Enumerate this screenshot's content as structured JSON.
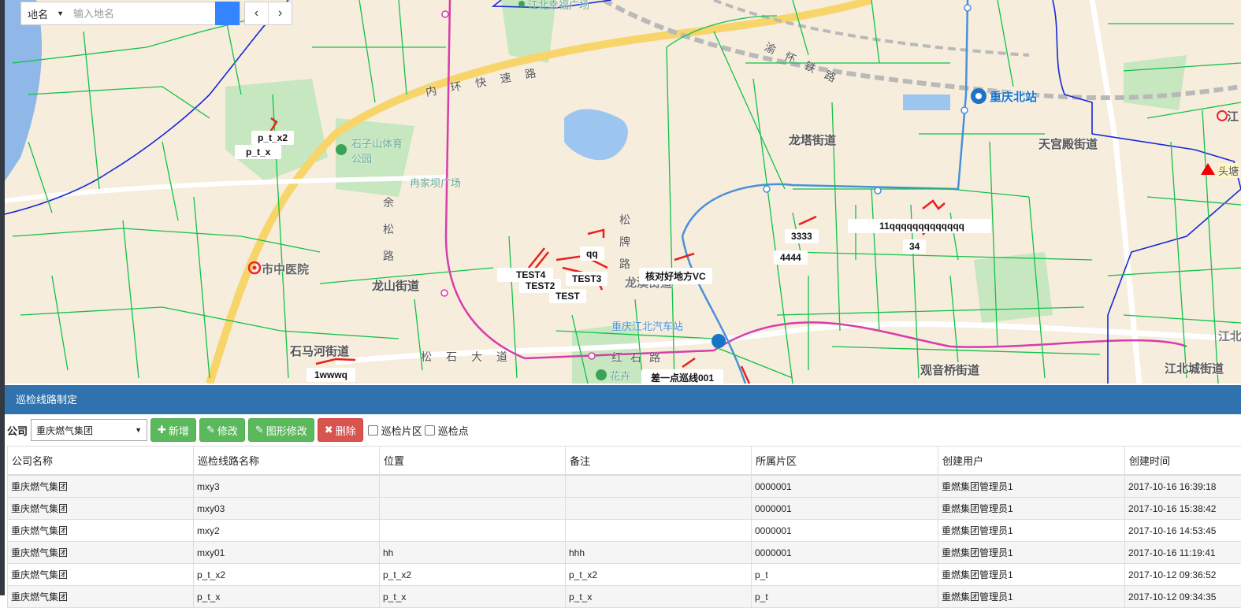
{
  "search": {
    "type_label": "地名",
    "placeholder": "输入地名"
  },
  "map": {
    "labels": [
      {
        "id": "ptx2",
        "text": "p_t_x2"
      },
      {
        "id": "ptx",
        "text": "p_t_x"
      },
      {
        "id": "3333",
        "text": "3333"
      },
      {
        "id": "4444",
        "text": "4444"
      },
      {
        "id": "11q",
        "text": "11qqqqqqqqqqqqq"
      },
      {
        "id": "34",
        "text": "34"
      },
      {
        "id": "qq",
        "text": "qq"
      },
      {
        "id": "test4",
        "text": "TEST4"
      },
      {
        "id": "test3",
        "text": "TEST3"
      },
      {
        "id": "test2",
        "text": "TEST2"
      },
      {
        "id": "test",
        "text": "TEST"
      },
      {
        "id": "vc",
        "text": "核对好地方VC"
      },
      {
        "id": "1wwwq",
        "text": "1wwwq"
      },
      {
        "id": "cha",
        "text": "差一点巡线001"
      }
    ],
    "pois": {
      "longshan": "龙山街道",
      "longta": "龙塔街道",
      "tiangong": "天宫殿街道",
      "shimahe": "石马河街道",
      "guanyinqiao": "观音桥街道",
      "jiangbeicheng": "江北城街道",
      "chongqingbei": "重庆北站",
      "shizhongyi": "市中医院",
      "ranjiaba": "冉家坝广场",
      "jiangbei_xingfu": "江北幸福广场",
      "toutang": "头塘",
      "longxi": "龙溪街道",
      "songshi": "松石大道",
      "neihuan": "内环快速路",
      "yuyu": "渝怀铁路",
      "songpai": "松牌路",
      "yusong": "余松路",
      "hongshi": "红石路",
      "jiangbei_corner": "江",
      "jiangbei_corner2": "江北",
      "bus_station": "重庆江北汽车站",
      "park": "石子山体育公园",
      "huashan": "花卉"
    }
  },
  "panel": {
    "title": "巡检线路制定"
  },
  "toolbar": {
    "company_label": "公司",
    "company_value": "重庆燃气集团",
    "add_label": "新增",
    "edit_label": "修改",
    "shape_edit_label": "图形修改",
    "delete_label": "删除",
    "chk_area_label": "巡检片区",
    "chk_point_label": "巡检点"
  },
  "table": {
    "columns": [
      "公司名称",
      "巡检线路名称",
      "位置",
      "备注",
      "所属片区",
      "创建用户",
      "创建时间"
    ],
    "rows": [
      [
        "重庆燃气集团",
        "mxy3",
        "",
        "",
        "0000001",
        "重燃集团管理员1",
        "2017-10-16 16:39:18"
      ],
      [
        "重庆燃气集团",
        "mxy03",
        "",
        "",
        "0000001",
        "重燃集团管理员1",
        "2017-10-16 15:38:42"
      ],
      [
        "重庆燃气集团",
        "mxy2",
        "",
        "",
        "0000001",
        "重燃集团管理员1",
        "2017-10-16 14:53:45"
      ],
      [
        "重庆燃气集团",
        "mxy01",
        "hh",
        "hhh",
        "0000001",
        "重燃集团管理员1",
        "2017-10-16 11:19:41"
      ],
      [
        "重庆燃气集团",
        "p_t_x2",
        "p_t_x2",
        "p_t_x2",
        "p_t",
        "重燃集团管理员1",
        "2017-10-12 09:36:52"
      ],
      [
        "重庆燃气集团",
        "p_t_x",
        "p_t_x",
        "p_t_x",
        "p_t",
        "重燃集团管理员1",
        "2017-10-12 09:34:35"
      ]
    ]
  },
  "colors": {
    "header_blue": "#2f72ad",
    "btn_green": "#5cb85c",
    "btn_red": "#d9534f",
    "pipe_green": "#12c14a",
    "route_red": "#e8201c",
    "boundary_blue": "#1428d8"
  }
}
